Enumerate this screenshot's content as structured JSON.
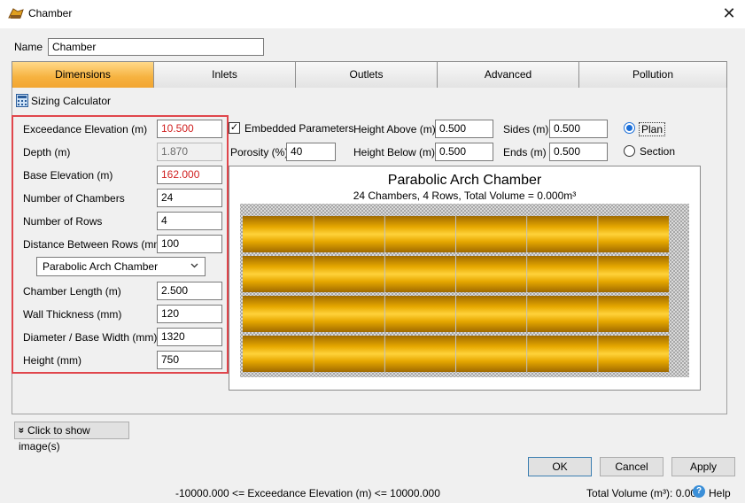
{
  "window": {
    "title": "Chamber",
    "close_glyph": "✕"
  },
  "name_field": {
    "label": "Name",
    "value": "Chamber"
  },
  "tabs": [
    {
      "label": "Dimensions",
      "active": true
    },
    {
      "label": "Inlets"
    },
    {
      "label": "Outlets"
    },
    {
      "label": "Advanced"
    },
    {
      "label": "Pollution"
    }
  ],
  "sizing": {
    "label": "Sizing Calculator"
  },
  "fields": {
    "exceedance": {
      "label": "Exceedance Elevation (m)",
      "value": "10.500"
    },
    "depth": {
      "label": "Depth (m)",
      "value": "1.870"
    },
    "base_elev": {
      "label": "Base Elevation (m)",
      "value": "162.000"
    },
    "num_chambers": {
      "label": "Number of Chambers",
      "value": "24"
    },
    "num_rows": {
      "label": "Number of Rows",
      "value": "4"
    },
    "dist_rows": {
      "label": "Distance Between Rows (mm)",
      "value": "100"
    },
    "chamber_type": {
      "value": "Parabolic Arch Chamber"
    },
    "chamber_length": {
      "label": "Chamber Length (m)",
      "value": "2.500"
    },
    "wall_thickness": {
      "label": "Wall Thickness (mm)",
      "value": "120"
    },
    "diameter": {
      "label": "Diameter / Base Width (mm)",
      "value": "1320"
    },
    "height": {
      "label": "Height (mm)",
      "value": "750"
    }
  },
  "embedded": {
    "label": "Embedded Parameters",
    "checked": true,
    "check_glyph": "✓",
    "porosity": {
      "label": "Porosity (%)",
      "value": "40"
    },
    "height_above": {
      "label": "Height Above (m)",
      "value": "0.500"
    },
    "height_below": {
      "label": "Height Below (m)",
      "value": "0.500"
    },
    "sides": {
      "label": "Sides (m)",
      "value": "0.500"
    },
    "ends": {
      "label": "Ends (m)",
      "value": "0.500"
    }
  },
  "view": {
    "plan": "Plan",
    "section": "Section",
    "selected": "plan"
  },
  "diagram": {
    "title": "Parabolic Arch Chamber",
    "subtitle": "24 Chambers, 4 Rows, Total Volume = 0.000m³",
    "rows": 4,
    "columns": 6
  },
  "show_images": {
    "label": "Click to show image(s)",
    "glyph": "»"
  },
  "buttons": {
    "ok": "OK",
    "cancel": "Cancel",
    "apply": "Apply"
  },
  "status": {
    "range": "-10000.000 <= Exceedance Elevation (m) <= 10000.000",
    "total_volume": "Total Volume (m³): 0.000",
    "help": "Help",
    "help_glyph": "?"
  },
  "colors": {
    "tab_active": "#f2a531",
    "highlight_box": "#e0464c",
    "invalid_text": "#d02020",
    "chamber_gold": "#e0a000",
    "radio_accent": "#1a6ed8"
  }
}
